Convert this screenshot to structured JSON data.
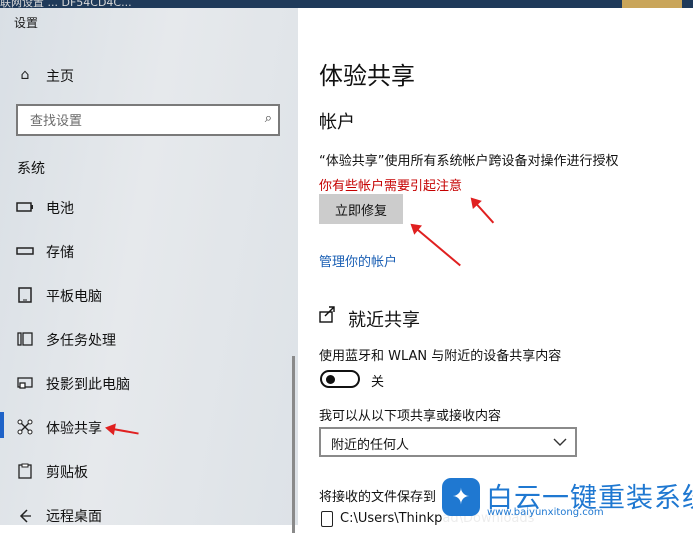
{
  "window": {
    "title": "设置",
    "background_strip": "联网设置 ... DF54CD4C..."
  },
  "sidebar": {
    "home_label": "主页",
    "search_placeholder": "查找设置",
    "section_title": "系统",
    "items": [
      {
        "label": "电池",
        "icon": "battery-icon"
      },
      {
        "label": "存储",
        "icon": "storage-icon"
      },
      {
        "label": "平板电脑",
        "icon": "tablet-icon"
      },
      {
        "label": "多任务处理",
        "icon": "multitasking-icon"
      },
      {
        "label": "投影到此电脑",
        "icon": "project-icon"
      },
      {
        "label": "体验共享",
        "icon": "shared-experiences-icon",
        "active": true
      },
      {
        "label": "剪贴板",
        "icon": "clipboard-icon"
      },
      {
        "label": "远程桌面",
        "icon": "remote-desktop-icon"
      }
    ]
  },
  "main": {
    "title": "体验共享",
    "accounts": {
      "heading": "帐户",
      "description": "“体验共享”使用所有系统帐户跨设备对操作进行授权",
      "warning": "你有些帐户需要引起注意",
      "fix_button": "立即修复",
      "manage_link": "管理你的帐户"
    },
    "nearby": {
      "heading": "就近共享",
      "toggle_label": "使用蓝牙和 WLAN 与附近的设备共享内容",
      "toggle_state": "关",
      "toggle_on": false,
      "receive_label": "我可以从以下项共享或接收内容",
      "receive_value": "附近的任何人",
      "save_label": "将接收的文件保存到",
      "save_path": "C:\\Users\\Thinkpad\\Downloads"
    }
  },
  "watermark": {
    "name": "白云一键重装系统",
    "url": "www.baiyunxitong.com"
  },
  "colors": {
    "accent": "#1f63c8",
    "warning": "#c50000",
    "link": "#1a5fb4",
    "arrow": "#e02020"
  }
}
